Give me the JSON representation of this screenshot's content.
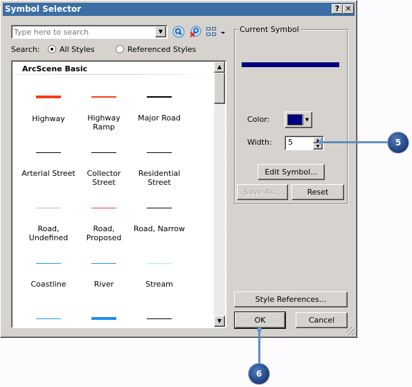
{
  "window": {
    "title": "Symbol Selector",
    "help_label": "?",
    "close_label": "✕"
  },
  "search": {
    "placeholder": "Type here to search",
    "value": "",
    "search_icon": "magnifier-icon",
    "clear_icon": "magnifier-clear-icon",
    "view_icon": "grid-view-icon",
    "scope_label": "Search:",
    "options": [
      {
        "label": "All Styles",
        "selected": true
      },
      {
        "label": "Referenced Styles",
        "selected": false
      }
    ]
  },
  "gallery": {
    "header": "ArcScene Basic",
    "items": [
      {
        "label": "Highway",
        "color": "#f43c14",
        "weight": "heavy"
      },
      {
        "label": "Highway Ramp",
        "color": "#f43c14",
        "weight": "medium"
      },
      {
        "label": "Major Road",
        "color": "#000000",
        "weight": "medium"
      },
      {
        "label": "Arterial Street",
        "color": "#000000",
        "weight": "thin"
      },
      {
        "label": "Collector Street",
        "color": "#000000",
        "weight": "thin"
      },
      {
        "label": "Residential Street",
        "color": "#000000",
        "weight": "thin"
      },
      {
        "label": "Road, Undefined",
        "color": "#c0c0c0",
        "weight": "thin"
      },
      {
        "label": "Road, Proposed",
        "color": "#f03c30",
        "weight": "thin"
      },
      {
        "label": "Road, Narrow",
        "color": "#000000",
        "weight": "thin"
      },
      {
        "label": "Coastline",
        "color": "#1e96f0",
        "weight": "thin"
      },
      {
        "label": "River",
        "color": "#1e96f0",
        "weight": "thin"
      },
      {
        "label": "Stream",
        "color": "#a0f0f0",
        "weight": "thin"
      },
      {
        "label": "",
        "color": "#1e96f0",
        "weight": "thin"
      },
      {
        "label": "",
        "color": "#1e8cf0",
        "weight": "heavy"
      },
      {
        "label": "",
        "color": "#000000",
        "weight": "thin"
      }
    ]
  },
  "current_symbol": {
    "group_label": "Current Symbol",
    "preview_color": "#000080",
    "color_label": "Color:",
    "color_value": "#000080",
    "width_label": "Width:",
    "width_value": "5",
    "edit_symbol_label": "Edit Symbol...",
    "save_as_label": "Save As...",
    "reset_label": "Reset"
  },
  "buttons": {
    "style_references_label": "Style References...",
    "ok_label": "OK",
    "cancel_label": "Cancel"
  },
  "callouts": [
    {
      "number": "5",
      "target": "width-field"
    },
    {
      "number": "6",
      "target": "ok-button"
    }
  ]
}
